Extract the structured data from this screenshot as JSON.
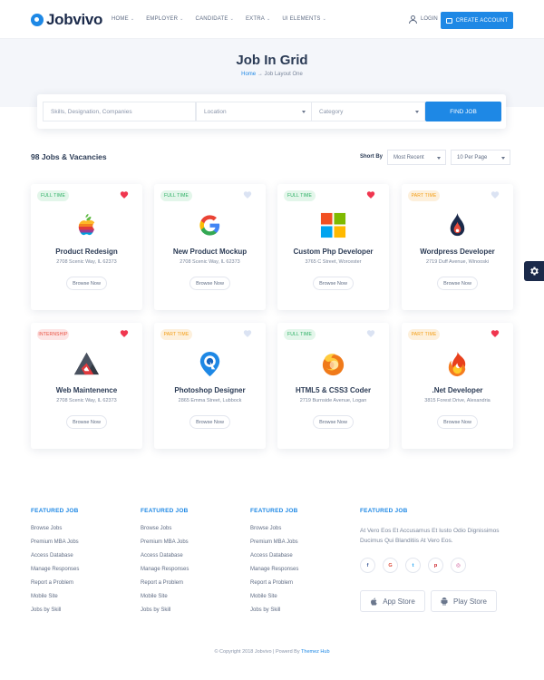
{
  "header": {
    "logo_text": "Jobvivo",
    "nav": [
      "HOME",
      "EMPLOYER",
      "CANDIDATE",
      "EXTRA",
      "UI ELEMENTS"
    ],
    "login_label": "LOGIN",
    "create_account_label": "CREATE ACCOUNT"
  },
  "hero": {
    "title": "Job In Grid",
    "breadcrumb_home": "Home",
    "breadcrumb_sep": "→",
    "breadcrumb_current": "Job Layout One"
  },
  "search": {
    "keywords_placeholder": "Skills, Designation, Companies",
    "location_label": "Location",
    "category_label": "Category",
    "find_button": "FIND JOB"
  },
  "listing": {
    "count_label": "98 Jobs & Vacancies",
    "sort_label": "Short By",
    "sort_value": "Most Recent",
    "per_page_value": "10 Per Page"
  },
  "jobs": [
    {
      "type": "FULL TIME",
      "title": "Product Redesign",
      "address": "2708 Scenic Way, IL 62373",
      "browse": "Browse Now",
      "favorite": true,
      "logo": "apple-logo"
    },
    {
      "type": "FULL TIME",
      "title": "New Product Mockup",
      "address": "2708 Scenic Way, IL 62373",
      "browse": "Browse Now",
      "favorite": false,
      "logo": "google-logo"
    },
    {
      "type": "FULL TIME",
      "title": "Custom Php Developer",
      "address": "3765 C Street, Worcester",
      "browse": "Browse Now",
      "favorite": true,
      "logo": "windows-logo"
    },
    {
      "type": "PART TIME",
      "title": "Wordpress Developer",
      "address": "2719 Duff Avenue, Winooski",
      "browse": "Browse Now",
      "favorite": false,
      "logo": "droplet-flame-logo"
    },
    {
      "type": "INTERNSHIP",
      "title": "Web Maintenence",
      "address": "2708 Scenic Way, IL 62373",
      "browse": "Browse Now",
      "favorite": true,
      "logo": "triangle-logo"
    },
    {
      "type": "PART TIME",
      "title": "Photoshop Designer",
      "address": "2865 Emma Street, Lubbock",
      "browse": "Browse Now",
      "favorite": false,
      "logo": "location-pin-logo"
    },
    {
      "type": "FULL TIME",
      "title": "HTML5 & CSS3 Coder",
      "address": "2719 Burnside Avenue, Logan",
      "browse": "Browse Now",
      "favorite": false,
      "logo": "firefox-logo"
    },
    {
      "type": "PART TIME",
      "title": ".Net Developer",
      "address": "3815 Forest Drive, Alexandria",
      "browse": "Browse Now",
      "favorite": true,
      "logo": "flame-logo"
    }
  ],
  "badge_colors": {
    "FULL TIME": {
      "bg": "#e3f6ea",
      "fg": "#27ae60"
    },
    "PART TIME": {
      "bg": "#fdf0dc",
      "fg": "#f39c12"
    },
    "INTERNSHIP": {
      "bg": "#fde5e5",
      "fg": "#e74c3c"
    }
  },
  "footer": {
    "columns": [
      {
        "heading": "FEATURED JOB",
        "links": [
          "Browse Jobs",
          "Premium MBA Jobs",
          "Access Database",
          "Manage Responses",
          "Report a Problem",
          "Mobile Site",
          "Jobs by Skill"
        ]
      },
      {
        "heading": "FEATURED JOB",
        "links": [
          "Browse Jobs",
          "Premium MBA Jobs",
          "Access Database",
          "Manage Responses",
          "Report a Problem",
          "Mobile Site",
          "Jobs by Skill"
        ]
      },
      {
        "heading": "FEATURED JOB",
        "links": [
          "Browse Jobs",
          "Premium MBA Jobs",
          "Access Database",
          "Manage Responses",
          "Report a Problem",
          "Mobile Site",
          "Jobs by Skill"
        ]
      }
    ],
    "about_heading": "FEATURED JOB",
    "about_text": "At Vero Eos Et Accusamus Et Iusto Odio Dignissimos Ducimus Qui Blanditiis At Vero Eos.",
    "socials": [
      {
        "name": "facebook-icon",
        "glyph": "f",
        "color": "#3b5998"
      },
      {
        "name": "google-plus-icon",
        "glyph": "G",
        "color": "#dd4b39"
      },
      {
        "name": "twitter-icon",
        "glyph": "t",
        "color": "#1da1f2"
      },
      {
        "name": "pinterest-icon",
        "glyph": "p",
        "color": "#cb2027"
      },
      {
        "name": "instagram-icon",
        "glyph": "◎",
        "color": "#c13584"
      }
    ],
    "app_store_label": "App Store",
    "play_store_label": "Play Store",
    "copyright_prefix": "© Copyright 2018 Jobvivo | Powerd By",
    "copyright_brand": "Themez Hub"
  },
  "colors": {
    "accent": "#1e88e5",
    "heart_active": "#f0364f",
    "heart_inactive": "#dbe3f3",
    "dark": "#1b2a4a"
  }
}
